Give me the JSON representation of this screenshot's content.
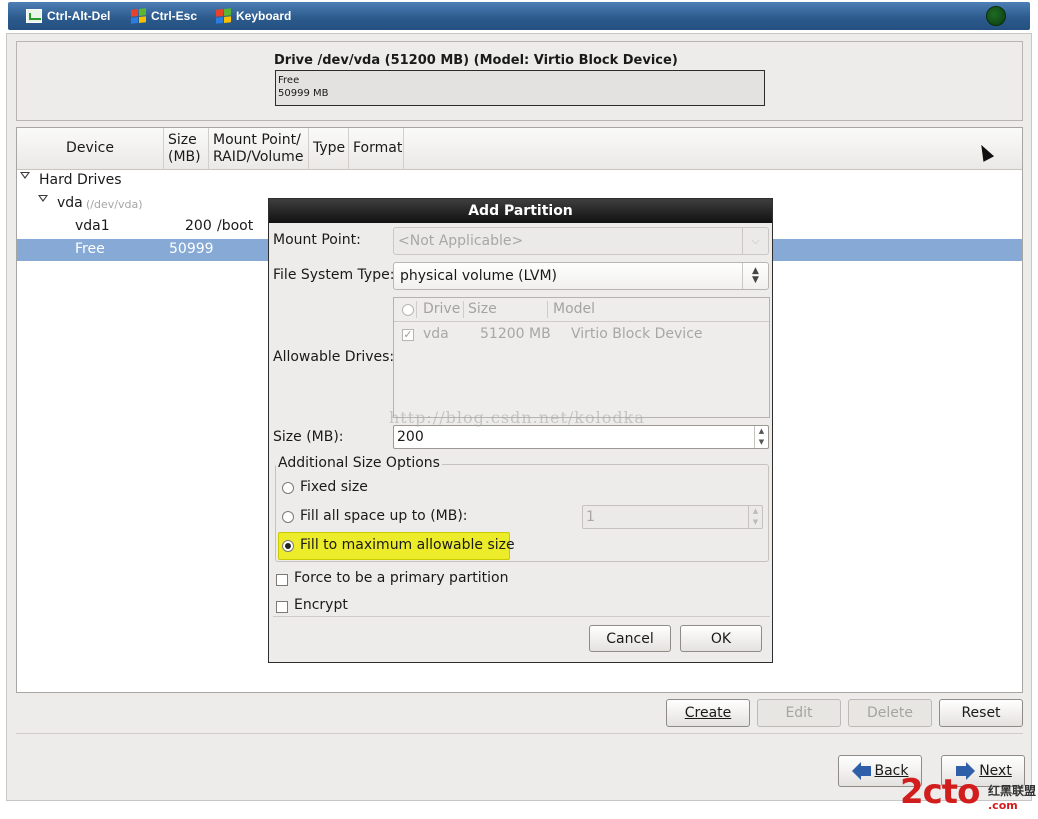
{
  "toolbar": {
    "ctrl_alt_del": "Ctrl-Alt-Del",
    "ctrl_esc": "Ctrl-Esc",
    "keyboard": "Keyboard"
  },
  "drive": {
    "title": "Drive /dev/vda (51200 MB) (Model: Virtio Block Device)",
    "free_label": "Free",
    "free_size": "50999 MB"
  },
  "tree": {
    "columns": {
      "device": "Device",
      "size": "Size\n(MB)",
      "mount": "Mount Point/\nRAID/Volume",
      "type": "Type",
      "format": "Format"
    },
    "hard_drives": "Hard Drives",
    "vda_label": "vda",
    "vda_path": "(/dev/vda)",
    "vda1": {
      "name": "vda1",
      "size": "200",
      "mount": "/boot"
    },
    "free": {
      "name": "Free",
      "size": "50999"
    }
  },
  "actions": {
    "create": "Create",
    "edit": "Edit",
    "delete": "Delete",
    "reset": "Reset"
  },
  "nav": {
    "back": "Back",
    "next": "Next"
  },
  "dialog": {
    "title": "Add Partition",
    "mount_point_label": "Mount Point:",
    "mount_point_value": "<Not Applicable>",
    "fs_type_label": "File System Type:",
    "fs_type_value": "physical volume (LVM)",
    "allowable_drives_label": "Allowable Drives:",
    "drives_columns": {
      "drive": "Drive",
      "size": "Size",
      "model": "Model"
    },
    "drives_rows": [
      {
        "drive": "vda",
        "size": "51200 MB",
        "model": "Virtio Block Device"
      }
    ],
    "size_label": "Size (MB):",
    "size_value": "200",
    "group_title": "Additional Size Options",
    "opt_fixed": "Fixed size",
    "opt_fill_up": "Fill all space up to (MB):",
    "fill_up_value": "1",
    "opt_fill_max": "Fill to maximum allowable size",
    "selected_option": "fill_max",
    "force_primary": "Force to be a primary partition",
    "encrypt": "Encrypt",
    "cancel": "Cancel",
    "ok": "OK",
    "watermark": "http://blog.csdn.net/kolodka"
  },
  "branding": {
    "logo": "2cto",
    "logo_domain": ".com",
    "logo_sub": "红黑联盟"
  },
  "colors": {
    "toolbar": "#2d5b8e",
    "selection": "#86a9d6",
    "highlight": "#ecec2a",
    "logo": "#d21d1d"
  }
}
